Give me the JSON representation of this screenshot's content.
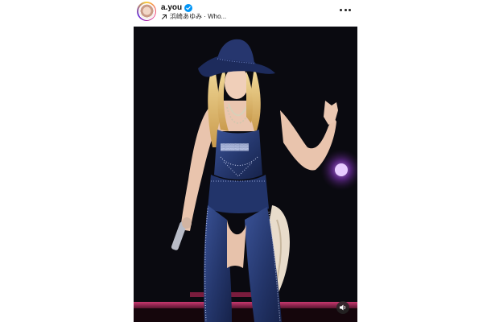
{
  "post": {
    "username": "a.you",
    "verified": true,
    "audio_label": "浜崎あゆみ · Who...",
    "more_label": "more-options-icon"
  },
  "media": {
    "description_icon": "stage-performance-photo",
    "mute_icon": "speaker-icon"
  },
  "colors": {
    "accent_blue": "#0095f6",
    "stage_bg": "#0a0a10",
    "stage_light": "#d23a74",
    "denim": "#2d3f7a"
  }
}
